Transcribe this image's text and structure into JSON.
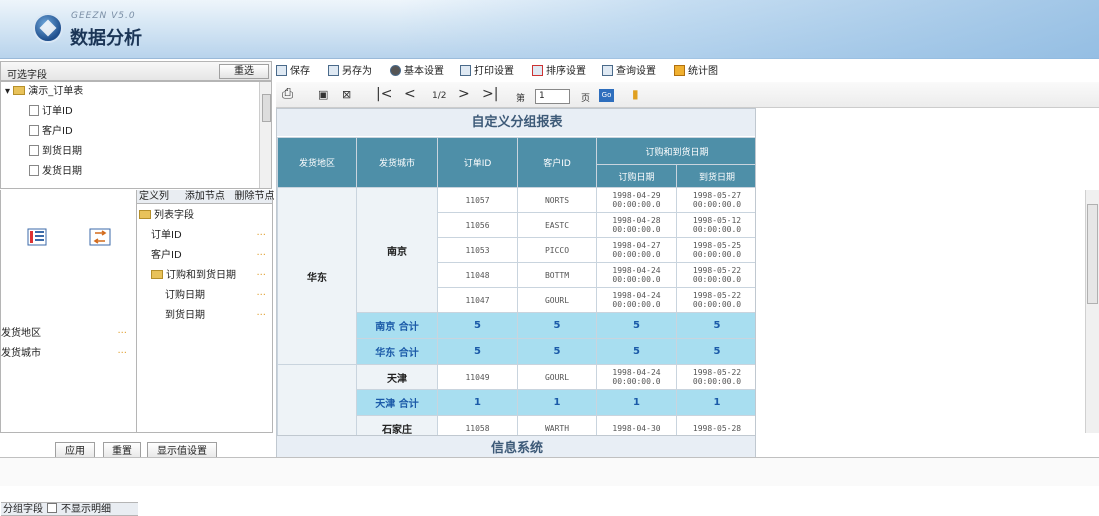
{
  "brand": {
    "sub": "GEEZN V5.0",
    "title": "数据分析"
  },
  "field_panel": {
    "label": "可选字段",
    "filter_button": "重选"
  },
  "tree": {
    "root": "演示_订单表",
    "fields": [
      "订单ID",
      "客户ID",
      "到货日期",
      "发货日期"
    ]
  },
  "define_panel": {
    "header_cols": [
      "定义列",
      "添加节点",
      "删除节点"
    ],
    "root": "列表字段",
    "items": [
      "订单ID",
      "客户ID"
    ],
    "group": "订购和到货日期",
    "group_items": [
      "订购日期",
      "到货日期"
    ]
  },
  "group_panel": {
    "label": "分组字段",
    "checkbox_label": "不显示明细",
    "fields": [
      "发货地区",
      "发货城市"
    ]
  },
  "bottom_buttons": {
    "apply": "应用",
    "reset": "重置",
    "display": "显示值设置"
  },
  "toolbar": {
    "items": [
      "保存",
      "另存为",
      "基本设置",
      "打印设置",
      "排序设置",
      "查询设置",
      "统计图"
    ],
    "page_indicator": "1/2",
    "page_prefix": "第",
    "page_value": "1",
    "page_suffix": "页",
    "go": "Go"
  },
  "report": {
    "title": "自定义分组报表",
    "footer": "信息系统",
    "headers": {
      "region": "发货地区",
      "city": "发货城市",
      "order_id": "订单ID",
      "customer_id": "客户ID",
      "group": "订购和到货日期",
      "order_date": "订购日期",
      "arrive_date": "到货日期"
    },
    "region1": "华东",
    "city1": "南京",
    "rows1": [
      {
        "id": "11057",
        "cust": "NORTS",
        "od1": "1998-04-29",
        "od2": "00:00:00.0",
        "ad1": "1998-05-27",
        "ad2": "00:00:00.0"
      },
      {
        "id": "11056",
        "cust": "EASTC",
        "od1": "1998-04-28",
        "od2": "00:00:00.0",
        "ad1": "1998-05-12",
        "ad2": "00:00:00.0"
      },
      {
        "id": "11053",
        "cust": "PICCO",
        "od1": "1998-04-27",
        "od2": "00:00:00.0",
        "ad1": "1998-05-25",
        "ad2": "00:00:00.0"
      },
      {
        "id": "11048",
        "cust": "BOTTM",
        "od1": "1998-04-24",
        "od2": "00:00:00.0",
        "ad1": "1998-05-22",
        "ad2": "00:00:00.0"
      },
      {
        "id": "11047",
        "cust": "GOURL",
        "od1": "1998-04-24",
        "od2": "00:00:00.0",
        "ad1": "1998-05-22",
        "ad2": "00:00:00.0"
      }
    ],
    "sub_city1": "南京 合计",
    "sub_city1_vals": [
      "5",
      "5",
      "5",
      "5"
    ],
    "sub_region1": "华东 合计",
    "sub_region1_vals": [
      "5",
      "5",
      "5",
      "5"
    ],
    "city2": "天津",
    "row2": {
      "id": "11049",
      "cust": "GOURL",
      "od1": "1998-04-24",
      "od2": "00:00:00.0",
      "ad1": "1998-05-22",
      "ad2": "00:00:00.0"
    },
    "sub_city2": "天津 合计",
    "sub_city2_vals": [
      "1",
      "1",
      "1",
      "1"
    ],
    "city3": "石家庄",
    "row3": {
      "id": "11058",
      "cust": "WARTH",
      "od1": "1998-04-30",
      "ad1": "1998-05-28"
    }
  }
}
